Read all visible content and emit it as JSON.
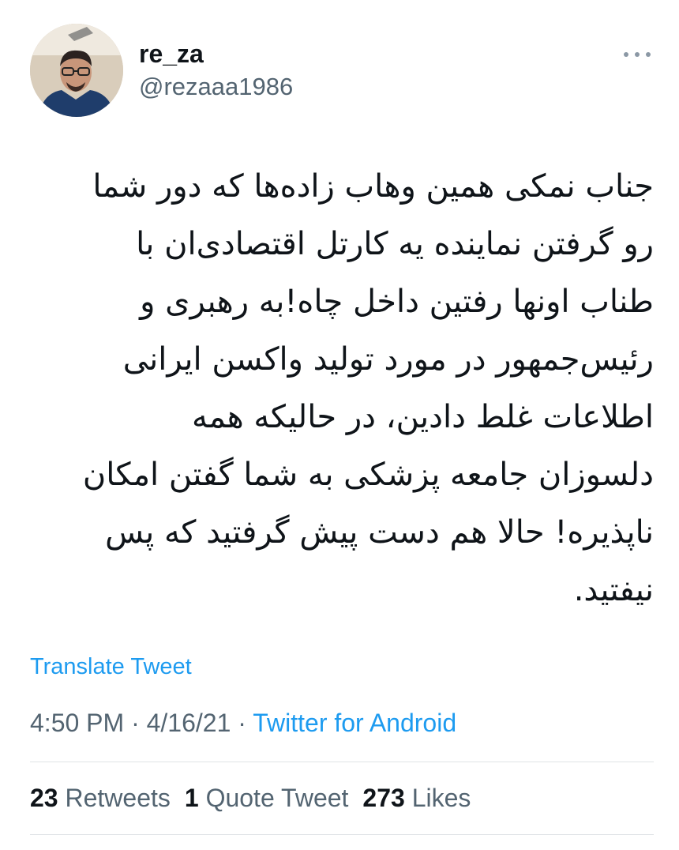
{
  "author": {
    "display_name": "re_za",
    "handle": "@rezaaa1986"
  },
  "tweet": {
    "text_lines": [
      "جناب نمکی همین وهاب زاده‌ها که دور شما",
      "رو گرفتن نماینده یه کارتل اقتصادی‌ان با",
      "طناب اونها رفتین داخل چاه!به رهبری و",
      "رئیس‌جمهور در مورد تولید واکسن ایرانی",
      "اطلاعات غلط دادین، در حالیکه همه",
      "دلسوزان جامعه پزشکی به شما گفتن امکان",
      "ناپذیره! حالا هم دست پیش گرفتید که پس",
      "نیفتید."
    ],
    "translate_label": "Translate Tweet"
  },
  "meta": {
    "time": "4:50 PM",
    "separator": " · ",
    "date": "4/16/21",
    "source": "Twitter for Android"
  },
  "stats": {
    "retweets_count": "23",
    "retweets_label": "Retweets",
    "quotes_count": "1",
    "quotes_label": "Quote Tweet",
    "likes_count": "273",
    "likes_label": "Likes"
  },
  "icons": {
    "more": "more-horizontal-icon"
  },
  "colors": {
    "link": "#1d9bf0",
    "secondary_text": "#536471",
    "primary_text": "#0f1419",
    "divider": "#dfe3e6"
  }
}
